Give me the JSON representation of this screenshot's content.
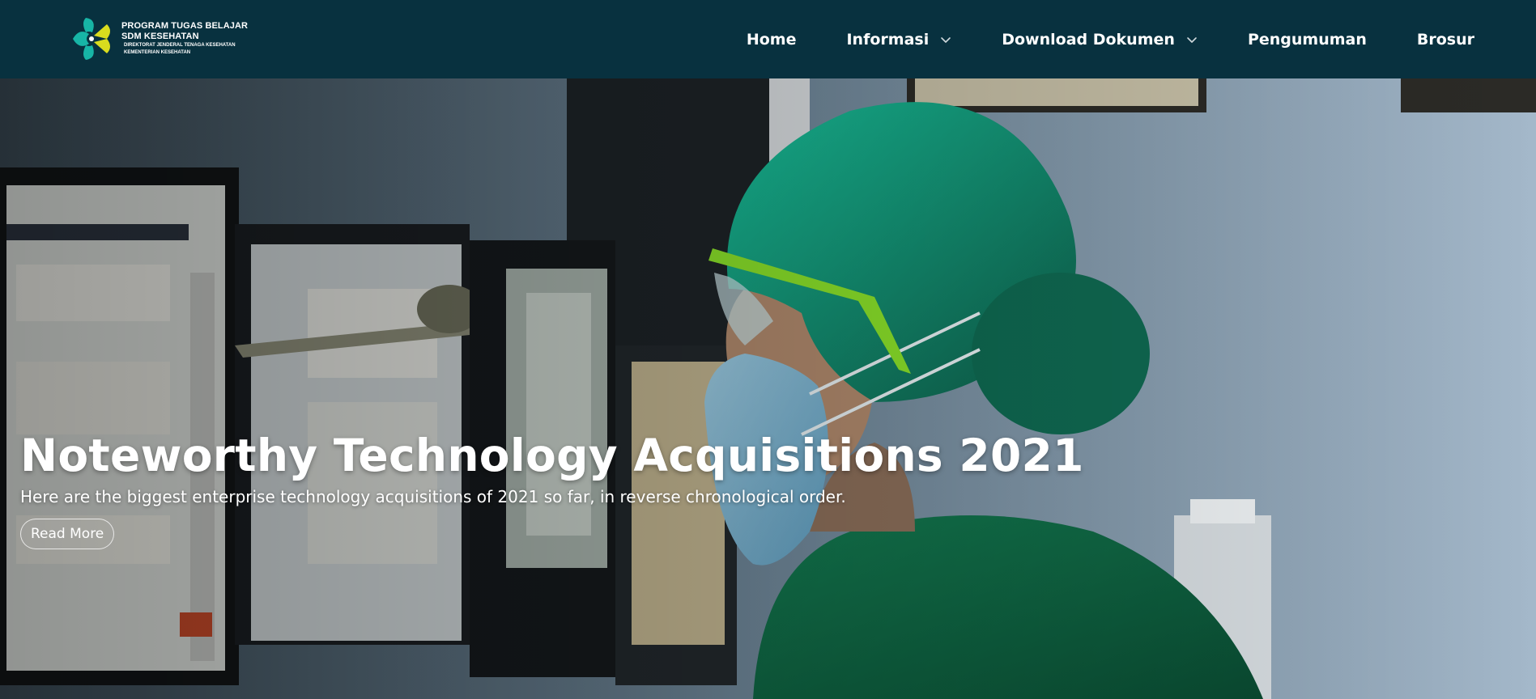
{
  "brand": {
    "line1": "PROGRAM TUGAS BELAJAR",
    "line2": "SDM KESEHATAN",
    "line3": "DIREKTORAT JENDERAL TENAGA KESEHATAN",
    "line4": "KEMENTERIAN KESEHATAN",
    "logo_icon": "kemenkes-logo",
    "colors": {
      "teal": "#17b5a6",
      "yellow": "#d9dc1e"
    }
  },
  "nav": {
    "items": [
      {
        "label": "Home",
        "has_dropdown": false
      },
      {
        "label": "Informasi",
        "has_dropdown": true
      },
      {
        "label": "Download Dokumen",
        "has_dropdown": true
      },
      {
        "label": "Pengumuman",
        "has_dropdown": false
      },
      {
        "label": "Brosur",
        "has_dropdown": false
      }
    ],
    "background": "#08313f",
    "dropdown_icon": "chevron-down-icon"
  },
  "hero": {
    "title": "Noteworthy Technology Acquisitions 2021",
    "subtitle": "Here are the biggest enterprise technology acquisitions of 2021 so far, in reverse chronological order.",
    "button_label": "Read More"
  }
}
